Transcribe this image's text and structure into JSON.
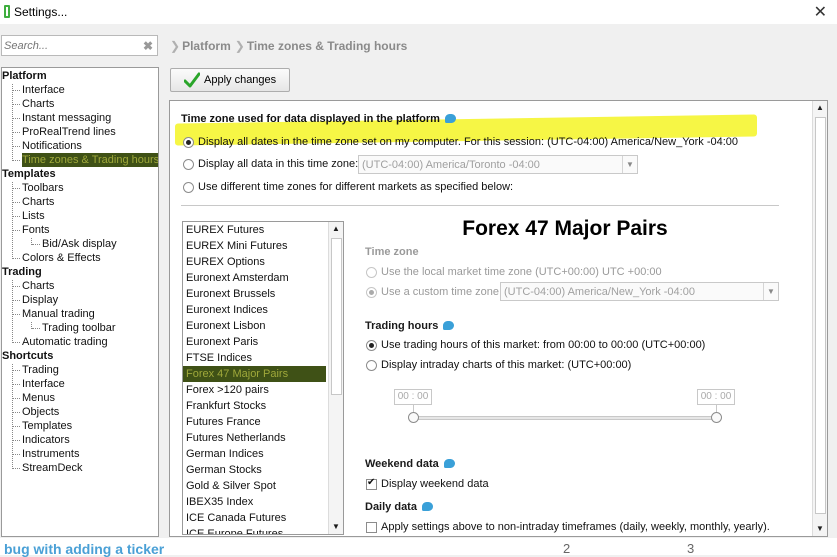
{
  "window": {
    "title": "Settings...",
    "close": "✕"
  },
  "search": {
    "placeholder": "Search...",
    "clear": "✖"
  },
  "breadcrumb": [
    "Platform",
    "Time zones & Trading hours"
  ],
  "tree": {
    "groups": [
      {
        "label": "Platform",
        "items": [
          {
            "label": "Interface",
            "level": 1
          },
          {
            "label": "Charts",
            "level": 1
          },
          {
            "label": "Instant messaging",
            "level": 1
          },
          {
            "label": "ProRealTrend lines",
            "level": 1
          },
          {
            "label": "Notifications",
            "level": 1
          },
          {
            "label": "Time zones & Trading hours",
            "level": 1,
            "selected": true
          }
        ]
      },
      {
        "label": "Templates",
        "items": [
          {
            "label": "Toolbars",
            "level": 1
          },
          {
            "label": "Charts",
            "level": 1
          },
          {
            "label": "Lists",
            "level": 1
          },
          {
            "label": "Fonts",
            "level": 1
          },
          {
            "label": "Bid/Ask display",
            "level": 2
          },
          {
            "label": "Colors & Effects",
            "level": 1
          }
        ]
      },
      {
        "label": "Trading",
        "items": [
          {
            "label": "Charts",
            "level": 1
          },
          {
            "label": "Display",
            "level": 1
          },
          {
            "label": "Manual trading",
            "level": 1
          },
          {
            "label": "Trading toolbar",
            "level": 2
          },
          {
            "label": "Automatic trading",
            "level": 1
          }
        ]
      },
      {
        "label": "Shortcuts",
        "items": [
          {
            "label": "Trading",
            "level": 1
          },
          {
            "label": "Interface",
            "level": 1
          },
          {
            "label": "Menus",
            "level": 1
          },
          {
            "label": "Objects",
            "level": 1
          },
          {
            "label": "Templates",
            "level": 1
          },
          {
            "label": "Indicators",
            "level": 1
          },
          {
            "label": "Instruments",
            "level": 1
          },
          {
            "label": "StreamDeck",
            "level": 1
          }
        ]
      }
    ]
  },
  "apply_button": "Apply changes",
  "timezone_section": {
    "title": "Time zone used for data displayed in the platform",
    "option1": "Display all dates in the time zone set on my computer. For this session:  (UTC-04:00) America/New_York -04:00",
    "option2": "Display all data in this time zone:",
    "option2_value": "(UTC-04:00) America/Toronto -04:00",
    "option3": "Use different time zones for different markets as specified below:"
  },
  "markets": {
    "items": [
      "EUREX Futures",
      "EUREX Mini Futures",
      "EUREX Options",
      "Euronext Amsterdam",
      "Euronext Brussels",
      "Euronext Indices",
      "Euronext Lisbon",
      "Euronext Paris",
      "FTSE Indices",
      "Forex 47 Major Pairs",
      "Forex >120 pairs",
      "Frankfurt Stocks",
      "Futures France",
      "Futures Netherlands",
      "German Indices",
      "German Stocks",
      "Gold & Silver Spot",
      "IBEX35 Index",
      "ICE Canada Futures",
      "ICE Europe Futures"
    ],
    "selected": "Forex 47 Major Pairs"
  },
  "detail": {
    "title": "Forex 47 Major Pairs",
    "timezone_heading": "Time zone",
    "tz_local": "Use the local market time zone (UTC+00:00) UTC +00:00",
    "tz_custom": "Use a custom time zone:",
    "tz_custom_value": "(UTC-04:00) America/New_York -04:00",
    "trading_heading": "Trading hours",
    "trading_opt1": "Use trading hours of this market: from 00:00 to 00:00  (UTC+00:00)",
    "trading_opt2": "Display intraday charts of this market:  (UTC+00:00)",
    "slider_start": "00 : 00",
    "slider_end": "00 : 00",
    "weekend_heading": "Weekend data",
    "weekend_opt": "Display weekend data",
    "daily_heading": "Daily data",
    "daily_opt": "Apply settings above to non-intraday timeframes (daily, weekly, monthly, yearly)."
  },
  "background": {
    "snippet": "bug with adding a ticker",
    "n1": "2",
    "n2": "3"
  },
  "colors": {
    "accent_selected_bg": "#3f5116",
    "accent_selected_fg": "#9fa83a",
    "highlight": "#f5f531",
    "info": "#3aa0d8"
  },
  "icons": {
    "app": "settings-app-icon",
    "close": "close-icon",
    "apply": "check-icon",
    "info": "info-bubble-icon"
  }
}
